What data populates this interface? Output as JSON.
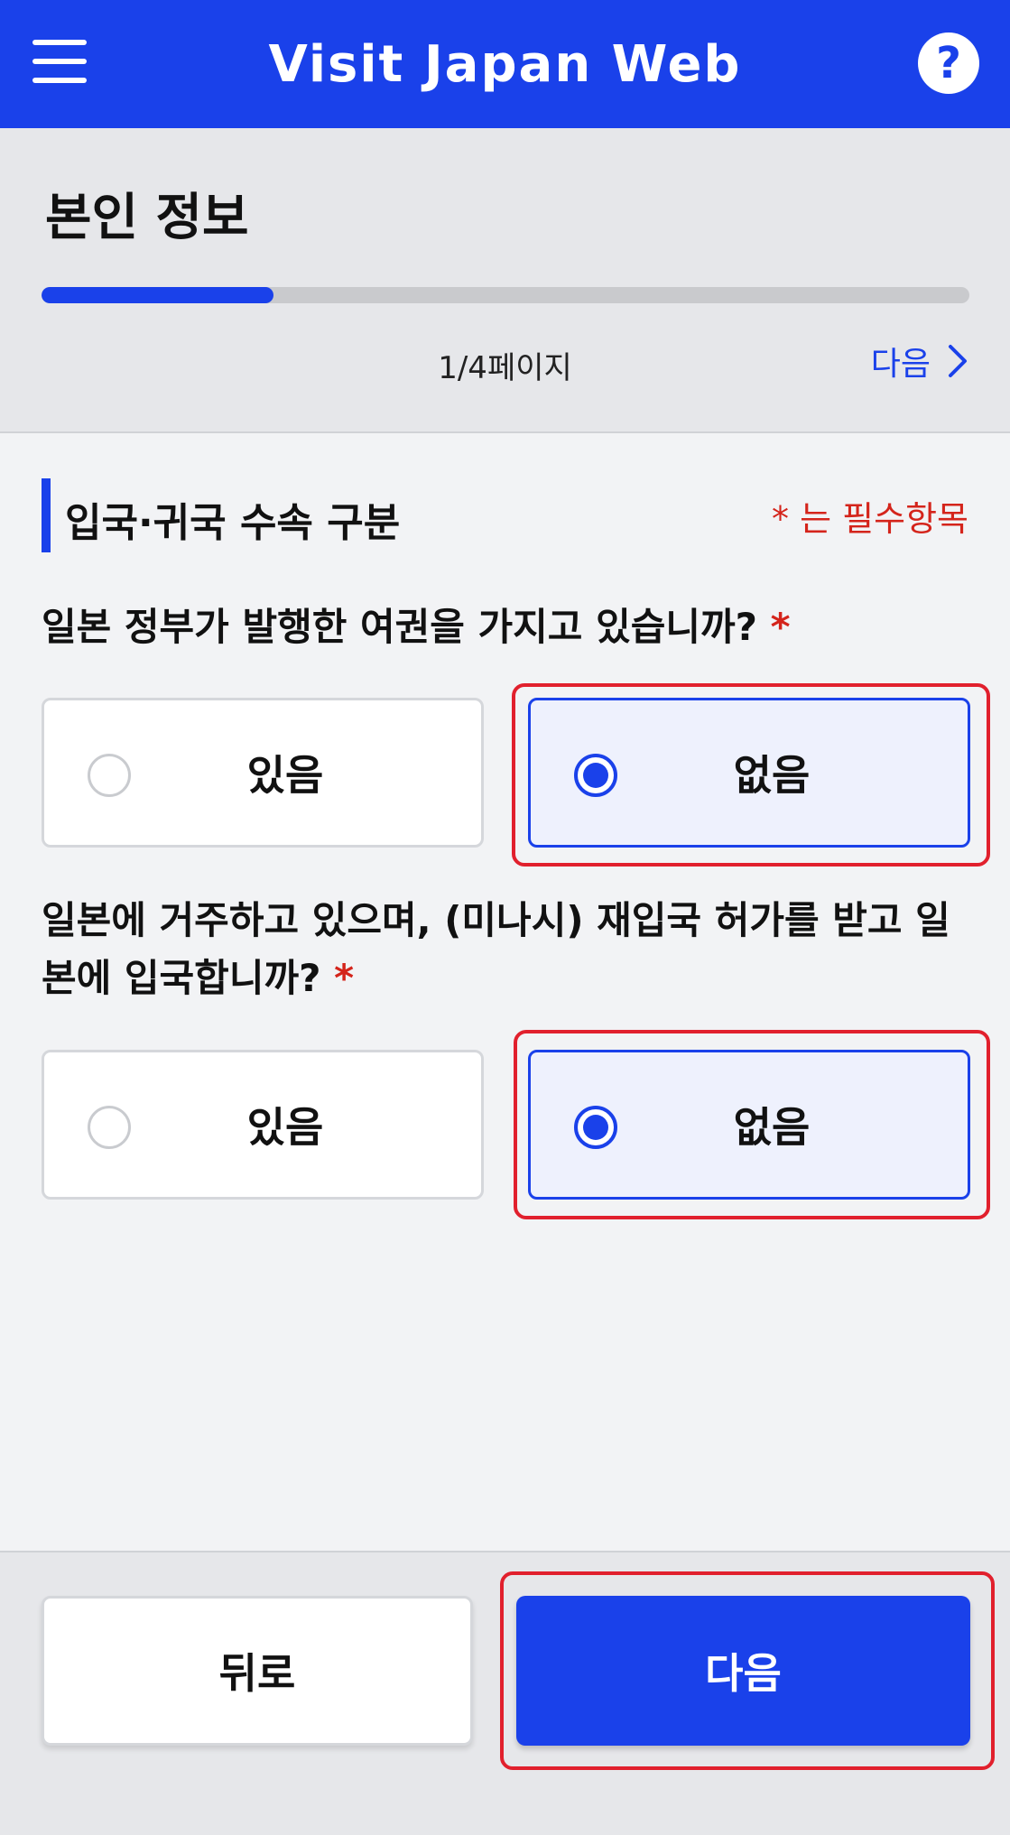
{
  "header": {
    "title": "Visit Japan Web",
    "help_glyph": "?"
  },
  "progress": {
    "page_title": "본인 정보",
    "page_indicator": "1/4페이지",
    "current_page": 1,
    "total_pages": 4,
    "fill_fraction": 0.25,
    "next_label": "다음"
  },
  "section": {
    "title": "입국·귀국 수속 구분",
    "required_note": "* 는 필수항목"
  },
  "questions": [
    {
      "text": "일본 정부가 발행한 여권을 가지고 있습니까?",
      "required_mark": "*",
      "options": [
        "있음",
        "없음"
      ],
      "selected": "없음"
    },
    {
      "text": "일본에 거주하고 있으며, (미나시) 재입국 허가를 받고 일본에 입국합니까?",
      "required_mark": "*",
      "options": [
        "있음",
        "없음"
      ],
      "selected": "없음"
    }
  ],
  "footer": {
    "back_label": "뒤로",
    "next_label": "다음"
  },
  "colors": {
    "brand_blue": "#1a41ea",
    "required_red": "#d4241b",
    "highlight_red": "#e1202d"
  },
  "icons": [
    "menu-icon",
    "help-icon",
    "chevron-right-icon",
    "radio-icon"
  ]
}
